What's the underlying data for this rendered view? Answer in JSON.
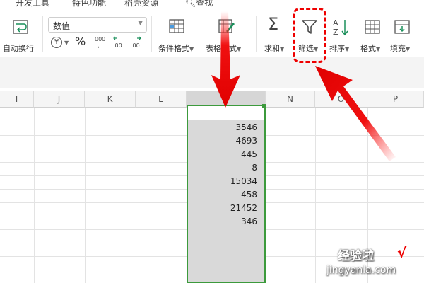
{
  "menu": {
    "items": [
      "开发工具",
      "特色功能",
      "稻壳资源",
      "查找"
    ]
  },
  "ribbon": {
    "wrap_text": "自动换行",
    "number_format": "数值",
    "currency_symbol": "¥",
    "percent_symbol": "%",
    "conditional_format": "条件格式",
    "table_style": "表格样式",
    "sum": "求和",
    "filter": "筛选",
    "sort": "排序",
    "format": "格式",
    "fill": "填充"
  },
  "sheet": {
    "columns": [
      "I",
      "J",
      "K",
      "L",
      "M",
      "N",
      "O",
      "P"
    ],
    "selected_column": "M",
    "values": [
      "3546",
      "4693",
      "445",
      "8",
      "15034",
      "458",
      "21452",
      "346"
    ]
  },
  "colors": {
    "accent_green": "#3c9a3c",
    "highlight_red": "#e00000"
  },
  "watermark": {
    "title": "经验啦",
    "check": "√",
    "url": "jingyanla.com"
  }
}
